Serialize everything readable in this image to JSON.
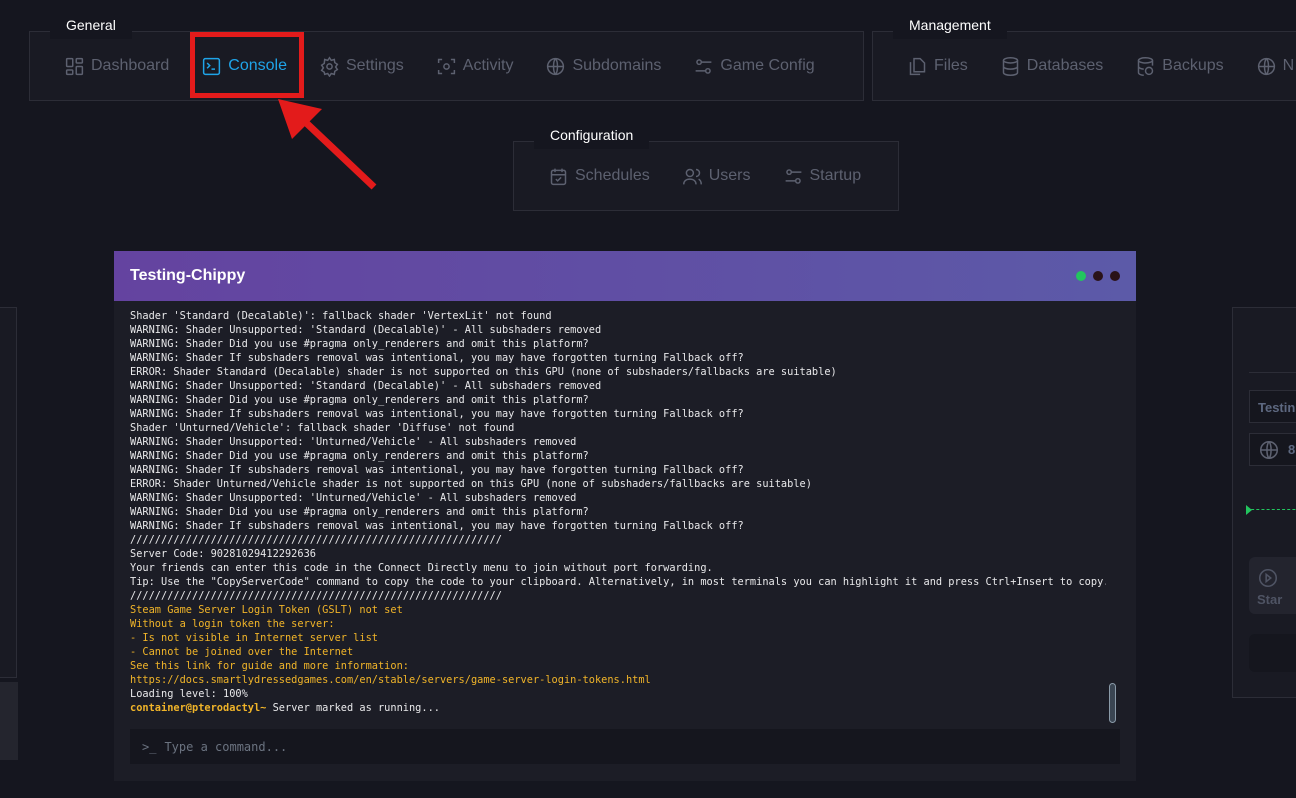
{
  "nav": {
    "general": {
      "label": "General",
      "items": [
        {
          "label": "Dashboard",
          "icon": "dashboard-icon"
        },
        {
          "label": "Console",
          "icon": "terminal-icon",
          "active": true
        },
        {
          "label": "Settings",
          "icon": "gear-icon"
        },
        {
          "label": "Activity",
          "icon": "activity-icon"
        },
        {
          "label": "Subdomains",
          "icon": "globe-icon"
        },
        {
          "label": "Game Config",
          "icon": "sliders-icon"
        }
      ]
    },
    "management": {
      "label": "Management",
      "items": [
        {
          "label": "Files",
          "icon": "files-icon"
        },
        {
          "label": "Databases",
          "icon": "database-icon"
        },
        {
          "label": "Backups",
          "icon": "backup-icon"
        },
        {
          "label": "N",
          "icon": "globe-icon"
        }
      ]
    },
    "configuration": {
      "label": "Configuration",
      "items": [
        {
          "label": "Schedules",
          "icon": "calendar-icon"
        },
        {
          "label": "Users",
          "icon": "users-icon"
        },
        {
          "label": "Startup",
          "icon": "sliders-icon"
        }
      ]
    }
  },
  "console": {
    "title": "Testing-Chippy",
    "lines": [
      {
        "text": "Shader 'Standard (Decalable)': fallback shader 'VertexLit' not found"
      },
      {
        "text": "WARNING: Shader Unsupported: 'Standard (Decalable)' - All subshaders removed"
      },
      {
        "text": "WARNING: Shader Did you use #pragma only_renderers and omit this platform?"
      },
      {
        "text": "WARNING: Shader If subshaders removal was intentional, you may have forgotten turning Fallback off?"
      },
      {
        "text": "ERROR: Shader Standard (Decalable) shader is not supported on this GPU (none of subshaders/fallbacks are suitable)"
      },
      {
        "text": "WARNING: Shader Unsupported: 'Standard (Decalable)' - All subshaders removed"
      },
      {
        "text": "WARNING: Shader Did you use #pragma only_renderers and omit this platform?"
      },
      {
        "text": "WARNING: Shader If subshaders removal was intentional, you may have forgotten turning Fallback off?"
      },
      {
        "text": "Shader 'Unturned/Vehicle': fallback shader 'Diffuse' not found"
      },
      {
        "text": "WARNING: Shader Unsupported: 'Unturned/Vehicle' - All subshaders removed"
      },
      {
        "text": "WARNING: Shader Did you use #pragma only_renderers and omit this platform?"
      },
      {
        "text": "WARNING: Shader If subshaders removal was intentional, you may have forgotten turning Fallback off?"
      },
      {
        "text": "ERROR: Shader Unturned/Vehicle shader is not supported on this GPU (none of subshaders/fallbacks are suitable)"
      },
      {
        "text": "WARNING: Shader Unsupported: 'Unturned/Vehicle' - All subshaders removed"
      },
      {
        "text": "WARNING: Shader Did you use #pragma only_renderers and omit this platform?"
      },
      {
        "text": "WARNING: Shader If subshaders removal was intentional, you may have forgotten turning Fallback off?"
      },
      {
        "text": "////////////////////////////////////////////////////////////"
      },
      {
        "text": "Server Code: 90281029412292636"
      },
      {
        "text": "Your friends can enter this code in the Connect Directly menu to join without port forwarding."
      },
      {
        "text": "Tip: Use the \"CopyServerCode\" command to copy the code to your clipboard. Alternatively, in most terminals you can highlight it and press Ctrl+Insert to copy."
      },
      {
        "text": "////////////////////////////////////////////////////////////"
      },
      {
        "text": "Steam Game Server Login Token (GSLT) not set",
        "warn": true
      },
      {
        "text": "Without a login token the server:",
        "warn": true
      },
      {
        "text": "- Is not visible in Internet server list",
        "warn": true
      },
      {
        "text": "- Cannot be joined over the Internet",
        "warn": true
      },
      {
        "text": "See this link for guide and more information:",
        "warn": true
      },
      {
        "text": "https://docs.smartlydressedgames.com/en/stable/servers/game-server-login-tokens.html",
        "warn": true
      },
      {
        "text": "Loading level: 100%"
      }
    ],
    "prompt_user": "container@pterodactyl~",
    "prompt_message": " Server marked as running...",
    "command_placeholder": "Type a command...",
    "status_color": "#22c55e"
  },
  "right_panel": {
    "server_name": "Testin",
    "address": "8",
    "start_label": "Star"
  },
  "annotation": {
    "highlight_color": "#e31b1b"
  }
}
